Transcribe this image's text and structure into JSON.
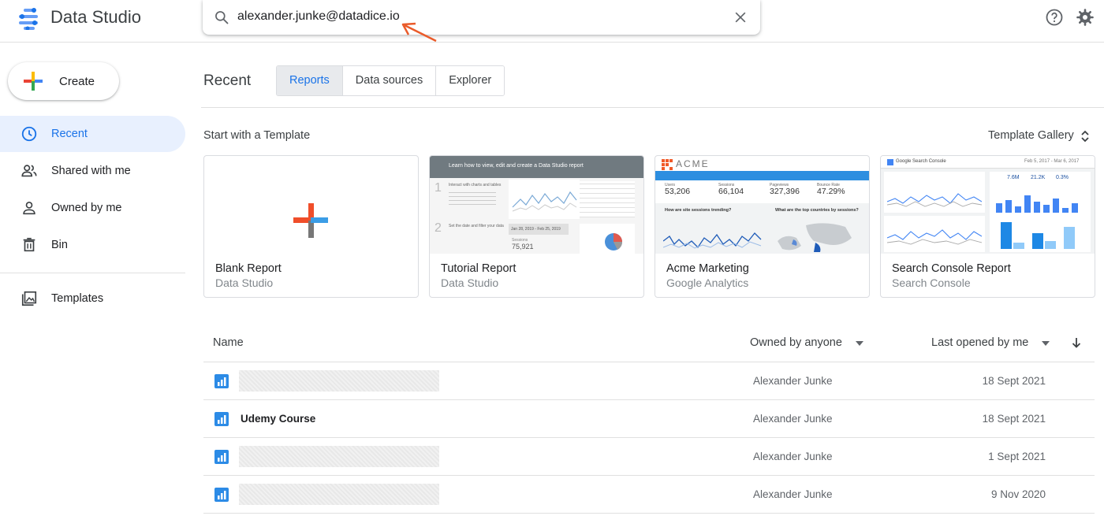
{
  "app": {
    "title": "Data Studio",
    "brand_colors": [
      "#4285f4",
      "#1a73e8",
      "#669df6"
    ]
  },
  "search": {
    "value": "alexander.junke@datadice.io",
    "annotation_color": "#ea5b2a"
  },
  "sidebar": {
    "create_label": "Create",
    "items": [
      {
        "label": "Recent",
        "icon": "clock-icon",
        "active": true
      },
      {
        "label": "Shared with me",
        "icon": "people-icon",
        "active": false
      },
      {
        "label": "Owned by me",
        "icon": "person-icon",
        "active": false
      },
      {
        "label": "Bin",
        "icon": "trash-icon",
        "active": false
      },
      {
        "label": "Templates",
        "icon": "image-icon",
        "active": false
      }
    ]
  },
  "main": {
    "title": "Recent",
    "tabs": [
      {
        "label": "Reports",
        "active": true
      },
      {
        "label": "Data sources",
        "active": false
      },
      {
        "label": "Explorer",
        "active": false
      }
    ],
    "templates_heading": "Start with a Template",
    "gallery_label": "Template Gallery",
    "templates": [
      {
        "title": "Blank Report",
        "subtitle": "Data Studio"
      },
      {
        "title": "Tutorial Report",
        "subtitle": "Data Studio"
      },
      {
        "title": "Acme Marketing",
        "subtitle": "Google Analytics"
      },
      {
        "title": "Search Console Report",
        "subtitle": "Search Console"
      }
    ]
  },
  "thumbs": {
    "tutorial": {
      "banner": "Learn how to view, edit and create a Data Studio report",
      "step1": "Interact with charts and tables",
      "step2": "Set the date and filter your data",
      "date_range": "Jan 28, 2019 - Feb 25, 2019",
      "sessions_label": "Sessions",
      "sessions_value": "75,921"
    },
    "acme": {
      "logo": "ACME",
      "metrics": [
        {
          "label": "Users",
          "value": "53,206"
        },
        {
          "label": "Sessions",
          "value": "66,104"
        },
        {
          "label": "Pageviews",
          "value": "327,396"
        },
        {
          "label": "Bounce Rate",
          "value": "47.29%"
        }
      ],
      "q1": "How are site sessions trending?",
      "q2": "What are the top countries by sessions?"
    },
    "search_console": {
      "title": "Google Search Console",
      "date_range": "Feb 5, 2017 - Mar 6, 2017",
      "values": [
        "7.6M",
        "21.2K",
        "0.3%"
      ]
    }
  },
  "table": {
    "columns": {
      "name": "Name",
      "owner_filter": "Owned by anyone",
      "date_sort": "Last opened by me"
    },
    "rows": [
      {
        "name": "",
        "redacted": true,
        "owner": "Alexander Junke",
        "date": "18 Sept 2021"
      },
      {
        "name": "Udemy Course",
        "redacted": false,
        "owner": "Alexander Junke",
        "date": "18 Sept 2021"
      },
      {
        "name": "",
        "redacted": true,
        "owner": "Alexander Junke",
        "date": "1 Sept 2021"
      },
      {
        "name": "",
        "redacted": true,
        "owner": "Alexander Junke",
        "date": "9 Nov 2020"
      }
    ]
  }
}
